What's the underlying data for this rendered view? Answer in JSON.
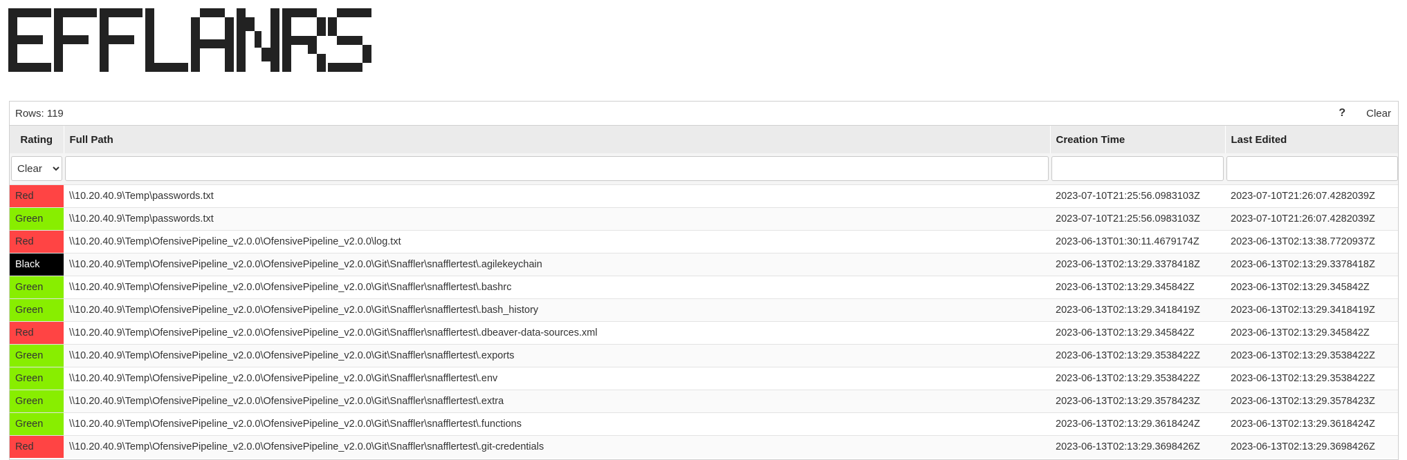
{
  "app": {
    "logo_text": "EFFLANRS"
  },
  "toolbar": {
    "rows_label": "Rows: 119",
    "help_label": "?",
    "clear_label": "Clear"
  },
  "columns": [
    "Rating",
    "Full Path",
    "Creation Time",
    "Last Edited"
  ],
  "filters": {
    "rating_selected": "Clear",
    "path_value": "",
    "creation_value": "",
    "edited_value": ""
  },
  "rating_colors": {
    "Red": "#ff4444",
    "Green": "#88ee00",
    "Black": "#000000"
  },
  "rows": [
    {
      "rating": "Red",
      "path": "\\\\10.20.40.9\\Temp\\passwords.txt",
      "created": "2023-07-10T21:25:56.0983103Z",
      "edited": "2023-07-10T21:26:07.4282039Z"
    },
    {
      "rating": "Green",
      "path": "\\\\10.20.40.9\\Temp\\passwords.txt",
      "created": "2023-07-10T21:25:56.0983103Z",
      "edited": "2023-07-10T21:26:07.4282039Z"
    },
    {
      "rating": "Red",
      "path": "\\\\10.20.40.9\\Temp\\OfensivePipeline_v2.0.0\\OfensivePipeline_v2.0.0\\log.txt",
      "created": "2023-06-13T01:30:11.4679174Z",
      "edited": "2023-06-13T02:13:38.7720937Z"
    },
    {
      "rating": "Black",
      "path": "\\\\10.20.40.9\\Temp\\OfensivePipeline_v2.0.0\\OfensivePipeline_v2.0.0\\Git\\Snaffler\\snafflertest\\.agilekeychain",
      "created": "2023-06-13T02:13:29.3378418Z",
      "edited": "2023-06-13T02:13:29.3378418Z"
    },
    {
      "rating": "Green",
      "path": "\\\\10.20.40.9\\Temp\\OfensivePipeline_v2.0.0\\OfensivePipeline_v2.0.0\\Git\\Snaffler\\snafflertest\\.bashrc",
      "created": "2023-06-13T02:13:29.345842Z",
      "edited": "2023-06-13T02:13:29.345842Z"
    },
    {
      "rating": "Green",
      "path": "\\\\10.20.40.9\\Temp\\OfensivePipeline_v2.0.0\\OfensivePipeline_v2.0.0\\Git\\Snaffler\\snafflertest\\.bash_history",
      "created": "2023-06-13T02:13:29.3418419Z",
      "edited": "2023-06-13T02:13:29.3418419Z"
    },
    {
      "rating": "Red",
      "path": "\\\\10.20.40.9\\Temp\\OfensivePipeline_v2.0.0\\OfensivePipeline_v2.0.0\\Git\\Snaffler\\snafflertest\\.dbeaver-data-sources.xml",
      "created": "2023-06-13T02:13:29.345842Z",
      "edited": "2023-06-13T02:13:29.345842Z"
    },
    {
      "rating": "Green",
      "path": "\\\\10.20.40.9\\Temp\\OfensivePipeline_v2.0.0\\OfensivePipeline_v2.0.0\\Git\\Snaffler\\snafflertest\\.exports",
      "created": "2023-06-13T02:13:29.3538422Z",
      "edited": "2023-06-13T02:13:29.3538422Z"
    },
    {
      "rating": "Green",
      "path": "\\\\10.20.40.9\\Temp\\OfensivePipeline_v2.0.0\\OfensivePipeline_v2.0.0\\Git\\Snaffler\\snafflertest\\.env",
      "created": "2023-06-13T02:13:29.3538422Z",
      "edited": "2023-06-13T02:13:29.3538422Z"
    },
    {
      "rating": "Green",
      "path": "\\\\10.20.40.9\\Temp\\OfensivePipeline_v2.0.0\\OfensivePipeline_v2.0.0\\Git\\Snaffler\\snafflertest\\.extra",
      "created": "2023-06-13T02:13:29.3578423Z",
      "edited": "2023-06-13T02:13:29.3578423Z"
    },
    {
      "rating": "Green",
      "path": "\\\\10.20.40.9\\Temp\\OfensivePipeline_v2.0.0\\OfensivePipeline_v2.0.0\\Git\\Snaffler\\snafflertest\\.functions",
      "created": "2023-06-13T02:13:29.3618424Z",
      "edited": "2023-06-13T02:13:29.3618424Z"
    },
    {
      "rating": "Red",
      "path": "\\\\10.20.40.9\\Temp\\OfensivePipeline_v2.0.0\\OfensivePipeline_v2.0.0\\Git\\Snaffler\\snafflertest\\.git-credentials",
      "created": "2023-06-13T02:13:29.3698426Z",
      "edited": "2023-06-13T02:13:29.3698426Z"
    }
  ]
}
